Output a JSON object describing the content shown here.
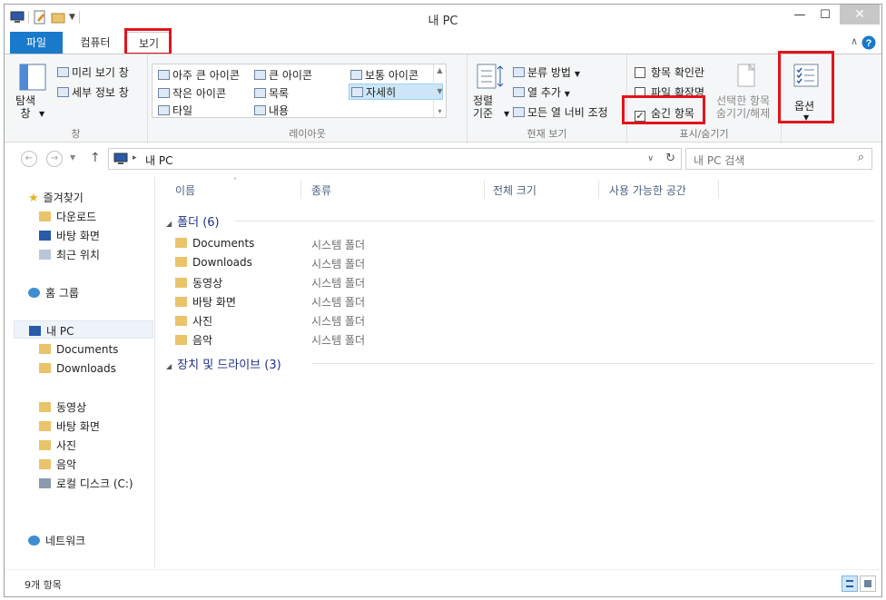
{
  "window": {
    "title": "내 PC"
  },
  "ribbon_tabs": {
    "file": "파일",
    "computer": "컴퓨터",
    "view": "보기"
  },
  "ribbon": {
    "pane_group": {
      "label": "창",
      "navigation_pane": "탐색\n창",
      "preview_pane": "미리 보기 창",
      "details_pane": "세부 정보 창"
    },
    "layout_group": {
      "label": "레이아웃",
      "items": [
        "아주 큰 아이콘",
        "큰 아이콘",
        "보통 아이콘",
        "작은 아이콘",
        "목록",
        "자세히",
        "타일",
        "내용"
      ],
      "selected": "자세히"
    },
    "current_view_group": {
      "label": "현재 보기",
      "sort_by": "정렬\n기준",
      "group_by": "분류 방법",
      "add_columns": "열 추가",
      "size_all_columns": "모든 열 너비 조정"
    },
    "show_hide_group": {
      "label": "표시/숨기기",
      "item_check_boxes": {
        "label": "항목 확인란",
        "checked": false
      },
      "file_extensions": {
        "label": "파일 확장명",
        "checked": false
      },
      "hidden_items": {
        "label": "숨긴 항목",
        "checked": true
      },
      "hide_selected": "선택한 항목\n숨기기/해제"
    },
    "options": {
      "label": "옵션"
    }
  },
  "address_bar": {
    "path": "내 PC",
    "search_placeholder": "내 PC 검색"
  },
  "nav_pane": {
    "favorites": "즐겨찾기",
    "favorites_items": [
      "다운로드",
      "바탕 화면",
      "최근 위치"
    ],
    "homegroup": "홈 그룹",
    "this_pc": "내 PC",
    "this_pc_items": [
      "Documents",
      "Downloads",
      "동영상",
      "바탕 화면",
      "사진",
      "음악",
      "로컬 디스크 (C:)"
    ],
    "network": "네트워크"
  },
  "file_list": {
    "columns": [
      "이름",
      "종류",
      "전체 크기",
      "사용 가능한 공간"
    ],
    "folders_header": "폴더 (6)",
    "folders": [
      {
        "name": "Documents",
        "type": "시스템 폴더"
      },
      {
        "name": "Downloads",
        "type": "시스템 폴더"
      },
      {
        "name": "동영상",
        "type": "시스템 폴더"
      },
      {
        "name": "바탕 화면",
        "type": "시스템 폴더"
      },
      {
        "name": "사진",
        "type": "시스템 폴더"
      },
      {
        "name": "음악",
        "type": "시스템 폴더"
      }
    ],
    "devices_header": "장치 및 드라이브 (3)"
  },
  "status_bar": {
    "item_count": "9개 항목"
  },
  "colors": {
    "accent": "#1979ca",
    "highlight": "#e3141b",
    "group_header": "#1e3287"
  }
}
